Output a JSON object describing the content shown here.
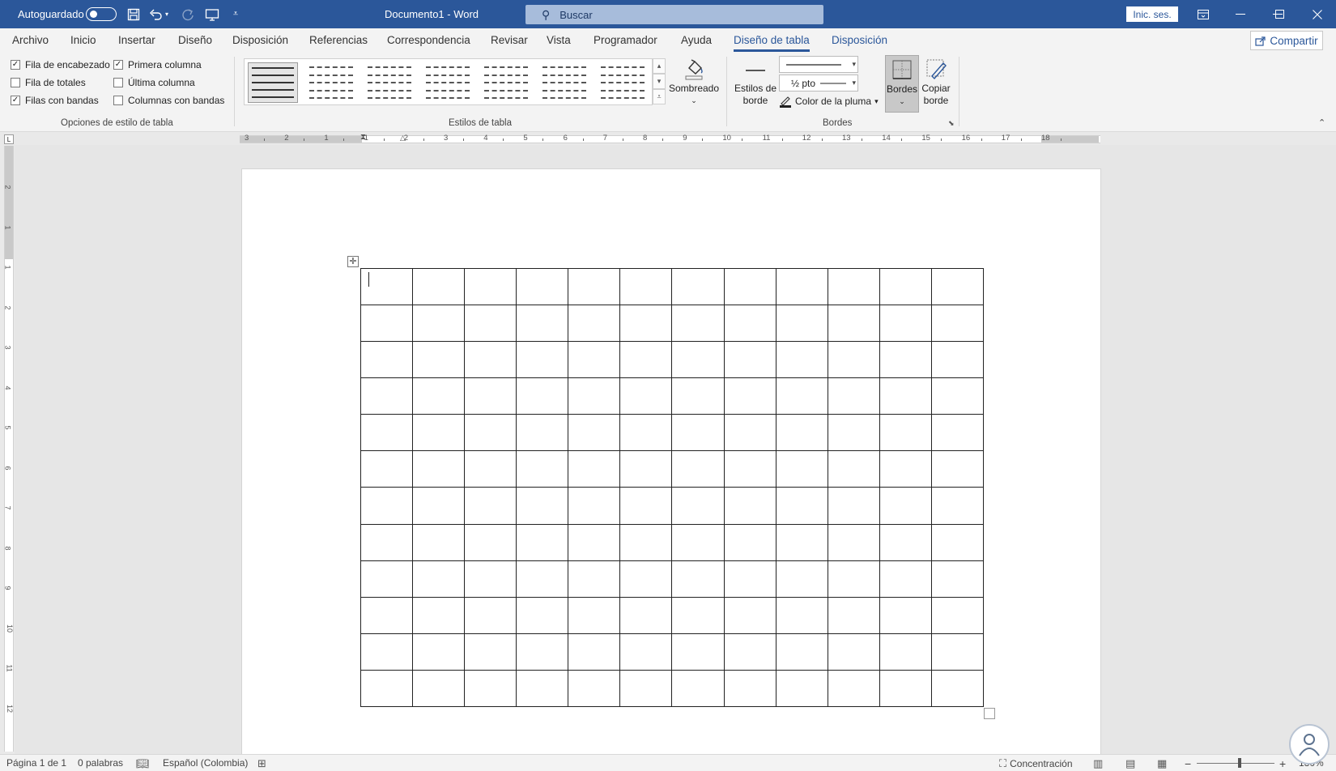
{
  "titlebar": {
    "autosave_label": "Autoguardado",
    "doc_title": "Documento1  -  Word",
    "search_placeholder": "Buscar",
    "signin_label": "Inic. ses."
  },
  "tabs": [
    "Archivo",
    "Inicio",
    "Insertar",
    "Diseño",
    "Disposición",
    "Referencias",
    "Correspondencia",
    "Revisar",
    "Vista",
    "Programador",
    "Ayuda",
    "Diseño de tabla",
    "Disposición"
  ],
  "active_tab": "Diseño de tabla",
  "share_label": "Compartir",
  "ribbon": {
    "table_style_options": {
      "group_label": "Opciones de estilo de tabla",
      "options": [
        {
          "label": "Fila de encabezado",
          "checked": true
        },
        {
          "label": "Fila de totales",
          "checked": false
        },
        {
          "label": "Filas con bandas",
          "checked": true
        },
        {
          "label": "Primera columna",
          "checked": true
        },
        {
          "label": "Última columna",
          "checked": false
        },
        {
          "label": "Columnas con bandas",
          "checked": false
        }
      ]
    },
    "table_styles": {
      "group_label": "Estilos de tabla",
      "shading_label": "Sombreado"
    },
    "borders": {
      "group_label": "Bordes",
      "border_styles_label": "Estilos de borde",
      "line_weight": "½ pto",
      "pen_color_label": "Color de la pluma",
      "borders_label": "Bordes",
      "border_painter_label": "Copiar borde"
    }
  },
  "hruler_numbers": [
    "3",
    "2",
    "1",
    "1",
    "2",
    "3",
    "4",
    "5",
    "6",
    "7",
    "8",
    "9",
    "10",
    "11",
    "12",
    "13",
    "14",
    "15",
    "16",
    "17",
    "18"
  ],
  "vruler_numbers": [
    "2",
    "1",
    "1",
    "2",
    "3",
    "4",
    "5",
    "6",
    "7",
    "8",
    "9",
    "10",
    "11",
    "12"
  ],
  "document": {
    "rows": 12,
    "cols": 12
  },
  "statusbar": {
    "page": "Página 1 de 1",
    "words": "0 palabras",
    "language": "Español (Colombia)",
    "focus": "Concentración",
    "zoom": "130%"
  },
  "colors": {
    "accent": "#2b579a",
    "ribbon_bg": "#f3f3f3",
    "canvas_bg": "#e6e6e6"
  }
}
